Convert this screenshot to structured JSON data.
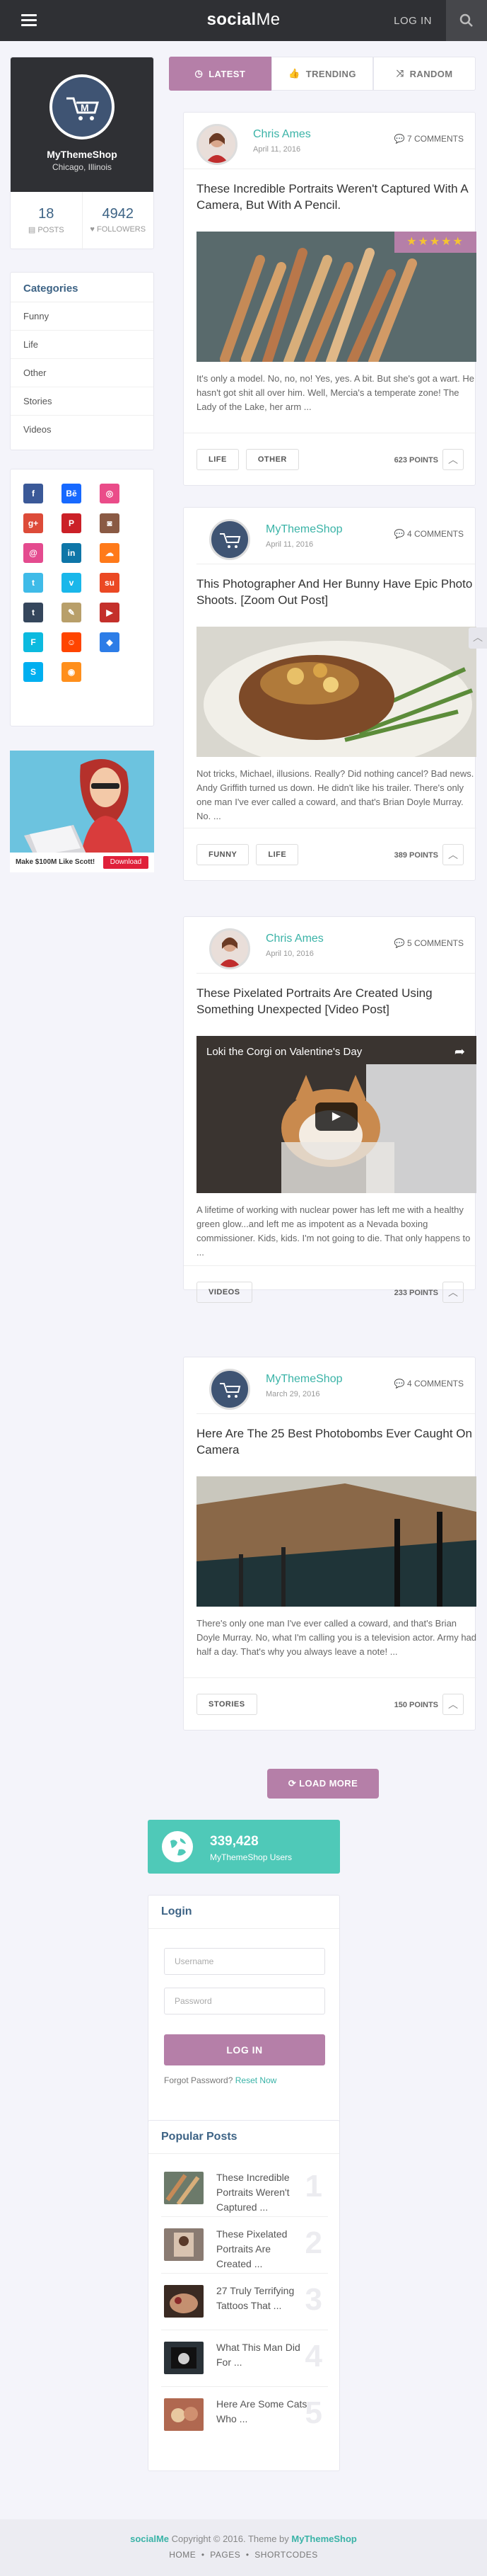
{
  "header": {
    "logo_main": "social",
    "logo_accent": "Me",
    "login_label": "LOG IN"
  },
  "profile": {
    "name": "MyThemeShop",
    "location": "Chicago, Illinois",
    "posts_count": "18",
    "posts_label": "POSTS",
    "followers_count": "4942",
    "followers_label": "FOLLOWERS"
  },
  "categories": {
    "title": "Categories",
    "items": [
      "Funny",
      "Life",
      "Other",
      "Stories",
      "Videos"
    ]
  },
  "social": {
    "icons": [
      {
        "name": "facebook-icon",
        "glyph": "f",
        "color": "#3b5998"
      },
      {
        "name": "behance-icon",
        "glyph": "Bē",
        "color": "#1769ff"
      },
      {
        "name": "dribbble-icon",
        "glyph": "◎",
        "color": "#ea4c89"
      },
      {
        "name": "googleplus-icon",
        "glyph": "g+",
        "color": "#dd4b39"
      },
      {
        "name": "pinterest-icon",
        "glyph": "P",
        "color": "#cb2027"
      },
      {
        "name": "instagram-icon",
        "glyph": "◙",
        "color": "#8a5a44"
      },
      {
        "name": "email-icon",
        "glyph": "@",
        "color": "#e44b8f"
      },
      {
        "name": "linkedin-icon",
        "glyph": "in",
        "color": "#0e76a8"
      },
      {
        "name": "soundcloud-icon",
        "glyph": "☁",
        "color": "#ff7a1a"
      },
      {
        "name": "twitter-icon",
        "glyph": "t",
        "color": "#3fbbe8"
      },
      {
        "name": "vimeo-icon",
        "glyph": "v",
        "color": "#1ab7ea"
      },
      {
        "name": "stumbleupon-icon",
        "glyph": "su",
        "color": "#eb4924"
      },
      {
        "name": "tumblr-icon",
        "glyph": "t",
        "color": "#35465c"
      },
      {
        "name": "flickr-icon",
        "glyph": "✎",
        "color": "#b89f6a"
      },
      {
        "name": "youtube-icon",
        "glyph": "▶",
        "color": "#c4302b"
      },
      {
        "name": "foursquare-icon",
        "glyph": "F",
        "color": "#0cbadf"
      },
      {
        "name": "reddit-icon",
        "glyph": "☺",
        "color": "#ff4500"
      },
      {
        "name": "dropbox-icon",
        "glyph": "◆",
        "color": "#2d7de7"
      },
      {
        "name": "skype-icon",
        "glyph": "S",
        "color": "#00aff0"
      },
      {
        "name": "rss-icon",
        "glyph": "◉",
        "color": "#ff8f1c"
      }
    ]
  },
  "ad": {
    "text": "Make $100M Like Scott!",
    "button": "Download"
  },
  "tabs": {
    "latest": "LATEST",
    "trending": "TRENDING",
    "random": "RANDOM"
  },
  "posts": [
    {
      "author": "Chris Ames",
      "date": "April 11, 2016",
      "comments": "7 COMMENTS",
      "title": "These Incredible Portraits Weren't Captured With A Camera, But With A Pencil.",
      "excerpt": "It's only a model. No, no, no! Yes, yes. A bit. But she's got a wart. He hasn't got shit all over him. Well, Mercia's a temperate zone! The Lady of the Lake, her arm ...",
      "tags": [
        "LIFE",
        "OTHER"
      ],
      "points": "623 POINTS",
      "rating": "★★★★★"
    },
    {
      "author": "MyThemeShop",
      "date": "April 11, 2016",
      "comments": "4 COMMENTS",
      "title": "This Photographer And Her Bunny Have Epic Photo Shoots. [Zoom Out Post]",
      "excerpt": "Not tricks, Michael, illusions. Really? Did nothing cancel? Bad news. Andy Griffith turned us down. He didn't like his trailer. There's only one man I've ever called a coward, and that's Brian Doyle Murray. No. ...",
      "tags": [
        "FUNNY",
        "LIFE"
      ],
      "points": "389 POINTS"
    },
    {
      "author": "Chris Ames",
      "date": "April 10, 2016",
      "comments": "5 COMMENTS",
      "title": "These Pixelated Portraits Are Created Using Something Unexpected [Video Post]",
      "excerpt": "A lifetime of working with nuclear power has left me with a healthy green glow...and left me as impotent as a Nevada boxing commissioner. Kids, kids. I'm not going to die. That only happens to ...",
      "tags": [
        "VIDEOS"
      ],
      "points": "233 POINTS",
      "video_title": "Loki the Corgi on Valentine's Day"
    },
    {
      "author": "MyThemeShop",
      "date": "March 29, 2016",
      "comments": "4 COMMENTS",
      "title": "Here Are The 25 Best Photobombs Ever Caught On Camera",
      "excerpt": "There's only one man I've ever called a coward, and that's Brian Doyle Murray. No, what I'm calling you is a television actor. Army had half a day. That's why you always leave a note! ...",
      "tags": [
        "STORIES"
      ],
      "points": "150 POINTS"
    }
  ],
  "load_more": "LOAD MORE",
  "users_widget": {
    "count": "339,428",
    "label": "MyThemeShop Users"
  },
  "login_widget": {
    "title": "Login",
    "username_placeholder": "Username",
    "password_placeholder": "Password",
    "button": "LOG IN",
    "forgot_text": "Forgot Password?",
    "reset_link": "Reset Now"
  },
  "popular": {
    "title": "Popular Posts",
    "items": [
      {
        "title": "These Incredible Portraits Weren't Captured ...",
        "num": "1"
      },
      {
        "title": "These Pixelated Portraits Are Created ...",
        "num": "2"
      },
      {
        "title": "27 Truly Terrifying Tattoos That ...",
        "num": "3"
      },
      {
        "title": "What This Man Did For ...",
        "num": "4"
      },
      {
        "title": "Here Are Some Cats Who ...",
        "num": "5"
      }
    ]
  },
  "footer": {
    "brand": "socialMe",
    "copyright": "Copyright © 2016. Theme by",
    "theme_link": "MyThemeShop",
    "nav": [
      "HOME",
      "PAGES",
      "SHORTCODES"
    ]
  }
}
